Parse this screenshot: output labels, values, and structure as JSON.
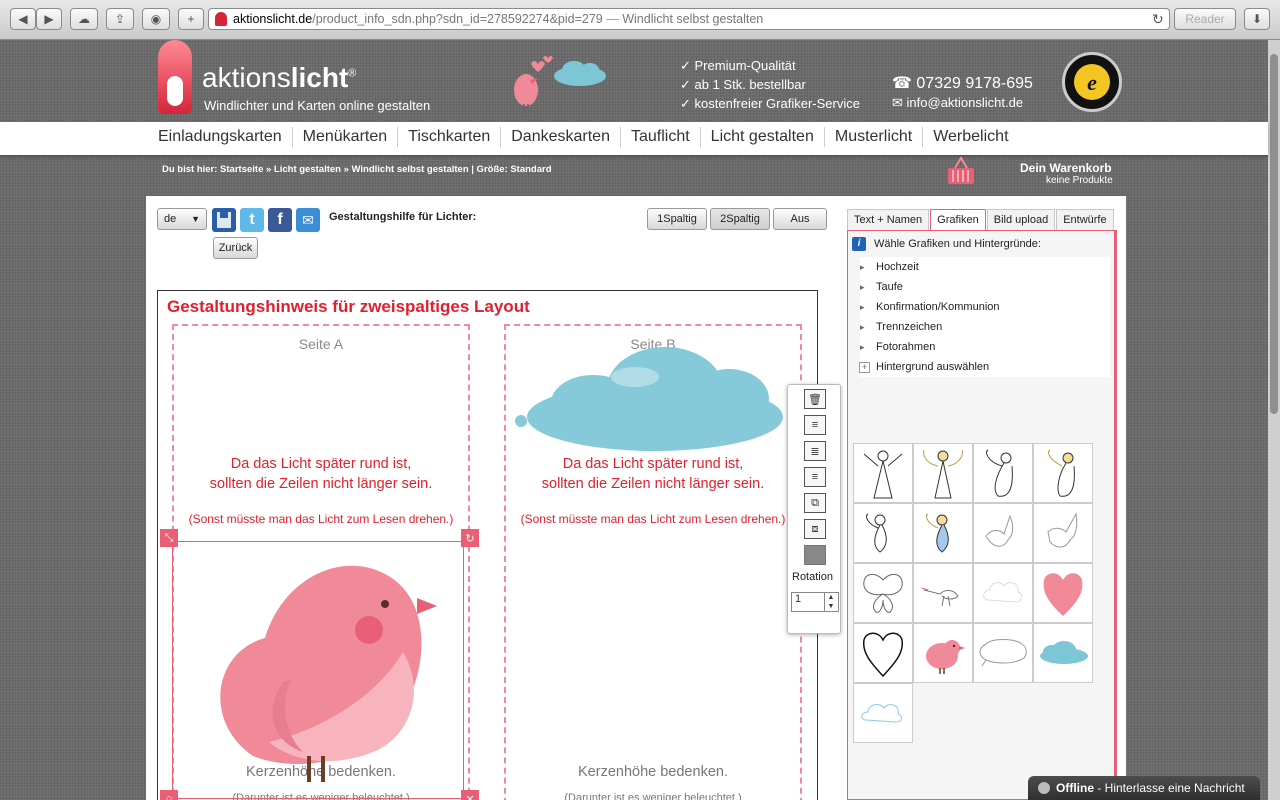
{
  "browser": {
    "url_domain": "aktionslicht.de",
    "url_path": "/product_info_sdn.php?sdn_id=278592274&pid=279",
    "page_title": "Windlicht selbst gestalten",
    "reader_label": "Reader",
    "add_tab_label": "+"
  },
  "header": {
    "logo_light": "aktions",
    "logo_bold": "licht",
    "logo_reg": "®",
    "tagline": "Windlichter und Karten online gestalten",
    "usps": [
      "Premium-Qualität",
      "ab 1 Stk. bestellbar",
      "kostenfreier Grafiker-Service"
    ],
    "phone": "07329 9178-695",
    "email": "info@aktionslicht.de"
  },
  "nav": {
    "items": [
      "Einladungskarten",
      "Menükarten",
      "Tischkarten",
      "Dankeskarten",
      "Tauflicht",
      "Licht gestalten",
      "Musterlicht",
      "Werbelicht"
    ]
  },
  "breadcrumb": {
    "text": "Du bist hier: Startseite » Licht gestalten » Windlicht selbst gestalten | Größe: Standard"
  },
  "cart": {
    "title": "Dein Warenkorb",
    "subtitle": "keine Produkte"
  },
  "toolbar": {
    "language": "de",
    "help_label": "Gestaltungshilfe für Lichter:",
    "back_label": "Zurück",
    "layout_buttons": [
      "1Spaltig",
      "2Spaltig",
      "Aus"
    ]
  },
  "canvas": {
    "hint_title": "Gestaltungshinweis für zweispaltiges Layout",
    "page_a_label": "Seite A",
    "page_b_label": "Seite B",
    "round_line1": "Da das Licht später rund ist,",
    "round_line2": "sollten die Zeilen nicht länger sein.",
    "round_note": "(Sonst müsste man das Licht zum Lesen drehen.)",
    "candle_note": "Kerzenhöhe bedenken.",
    "lit_note": "(Darunter ist es weniger beleuchtet.)"
  },
  "float_toolbar": {
    "rotation_label": "Rotation",
    "rotation_value": "1"
  },
  "panel": {
    "tabs": [
      "Text + Namen",
      "Grafiken",
      "Bild upload",
      "Entwürfe"
    ],
    "active_tab": 1,
    "title": "Wähle Grafiken und Hintergründe:",
    "categories": [
      "Hochzeit",
      "Taufe",
      "Konfirmation/Kommunion",
      "Trennzeichen",
      "Fotorahmen",
      "Hintergrund auswählen"
    ]
  },
  "chat": {
    "status": "Offline",
    "message": "- Hinterlasse eine Nachricht"
  },
  "colors": {
    "accent": "#e1202d",
    "pink": "#e95f75",
    "cloud": "#7cc6d6",
    "bird": "#f08a98"
  }
}
